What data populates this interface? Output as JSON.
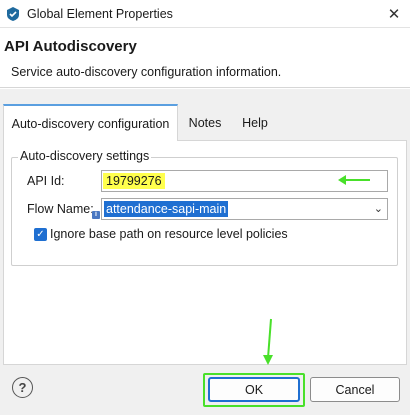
{
  "window": {
    "title": "Global Element Properties",
    "close_glyph": "✕",
    "app_icon": "shield-app-icon"
  },
  "header": {
    "title": "API Autodiscovery",
    "description": "Service auto-discovery configuration information."
  },
  "tabs": [
    {
      "label": "Auto-discovery configuration",
      "active": true
    },
    {
      "label": "Notes",
      "active": false
    },
    {
      "label": "Help",
      "active": false
    }
  ],
  "settings": {
    "group_title": "Auto-discovery settings",
    "api_id_label": "API Id:",
    "api_id_value": "19799276",
    "flow_name_label": "Flow Name:",
    "flow_name_value": "attendance-sapi-main",
    "info_glyph": "i",
    "ignore_base_path_label": "Ignore base path on resource level policies",
    "ignore_base_path_checked": true,
    "check_glyph": "✓"
  },
  "footer": {
    "help_glyph": "?",
    "ok_label": "OK",
    "cancel_label": "Cancel"
  },
  "colors": {
    "highlight_yellow": "#ffff4d",
    "selection_blue": "#1f6fd1",
    "annotation_green": "#49e02a",
    "tab_accent": "#5a9fe0"
  }
}
